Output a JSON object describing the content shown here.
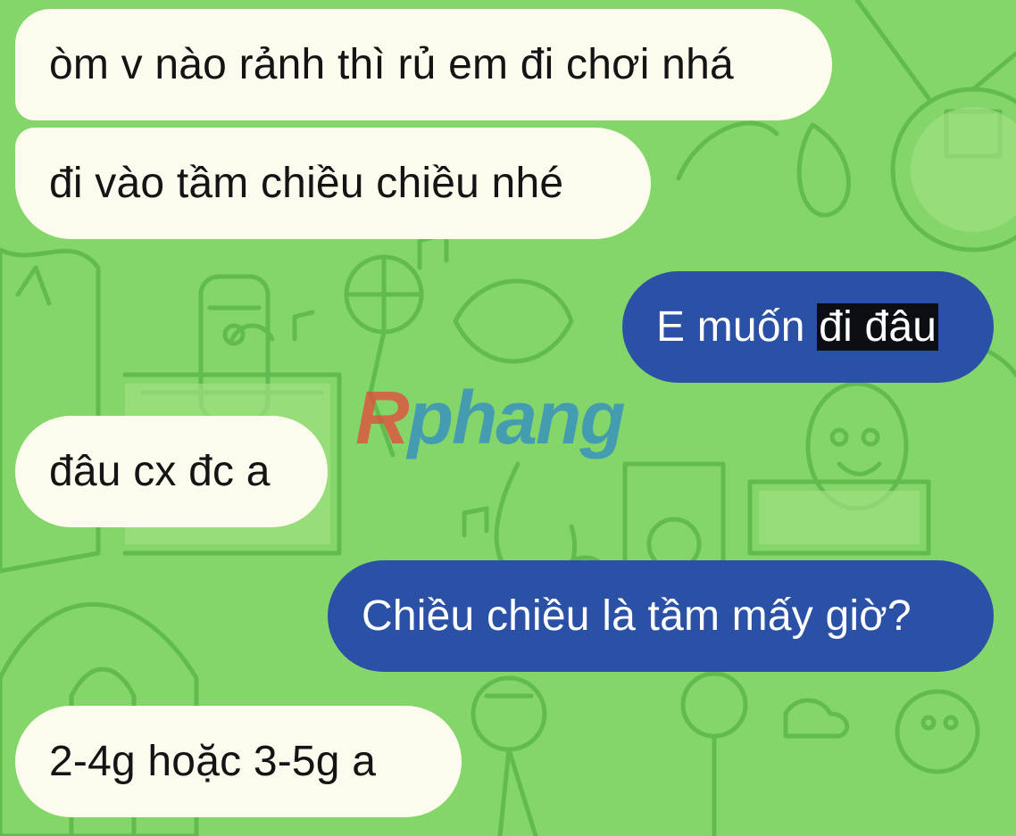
{
  "wallpaper": {
    "colors": {
      "background": "#84d66a",
      "line": "#5fb84c",
      "light": "#a6e38e"
    }
  },
  "watermark": {
    "first_letter": "R",
    "rest": "phang",
    "colors": {
      "first": "#e8463c",
      "rest": "#2e89c8"
    }
  },
  "messages": [
    {
      "direction": "incoming",
      "text": "òm v nào rảnh thì rủ em đi chơi nhá"
    },
    {
      "direction": "incoming",
      "text": "đi vào tầm chiều chiều nhé"
    },
    {
      "direction": "outgoing",
      "text_before": "E muốn ",
      "text_highlighted": "đi đâu"
    },
    {
      "direction": "incoming",
      "text": "đâu cx đc a"
    },
    {
      "direction": "outgoing",
      "text": "Chiều chiều là tầm mấy giờ?"
    },
    {
      "direction": "incoming",
      "text": "2-4g hoặc 3-5g a"
    }
  ],
  "colors": {
    "incoming_bubble": "#fdfbee",
    "outgoing_bubble": "#2a51a6",
    "highlight": "#0b0e12"
  }
}
